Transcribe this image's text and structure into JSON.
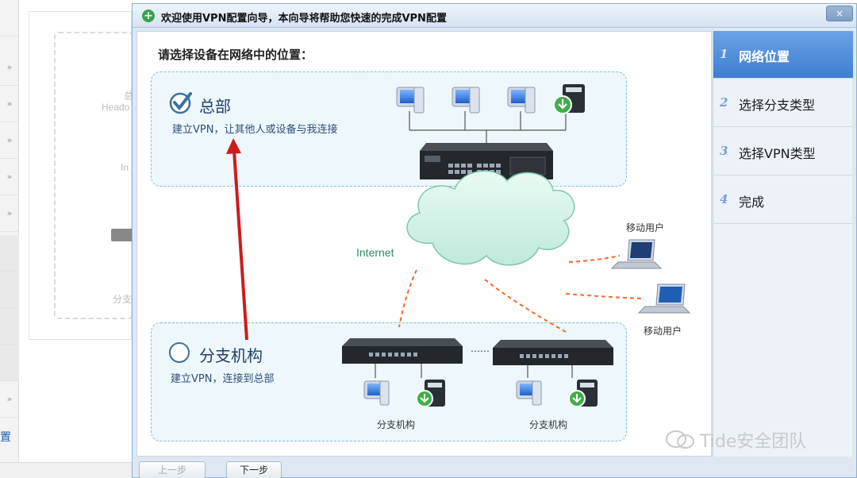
{
  "background": {
    "side_chevron": "»",
    "label_bottom_left": "置",
    "labels": [
      "总",
      "Heado",
      "In",
      "分支"
    ]
  },
  "dialog": {
    "title": "欢迎使用VPN配置向导，本向导将帮助您快速的完成VPN配置",
    "close_label": "×",
    "heading": "请选择设备在网络中的位置：",
    "hq": {
      "title": "总部",
      "description": "建立VPN，让其他人或设备与我连接",
      "selected": true
    },
    "branch": {
      "title": "分支机构",
      "description": "建立VPN，连接到总部",
      "selected": false
    },
    "diagram": {
      "internet_label": "Internet",
      "mobile_user_label": "移动用户",
      "branch_label": "分支机构",
      "ellipsis": "……"
    },
    "steps": [
      {
        "num": "1",
        "label": "网络位置",
        "active": true
      },
      {
        "num": "2",
        "label": "选择分支类型",
        "active": false
      },
      {
        "num": "3",
        "label": "选择VPN类型",
        "active": false
      },
      {
        "num": "4",
        "label": "完成",
        "active": false
      }
    ],
    "buttons": {
      "prev": "上一步",
      "next": "下一步"
    }
  },
  "watermark": "Tide安全团队",
  "colors": {
    "accent": "#3f7fd0",
    "title_icon": "#35a34a",
    "arrow": "#cc1c1c",
    "link_dash": "#f26a2b"
  }
}
